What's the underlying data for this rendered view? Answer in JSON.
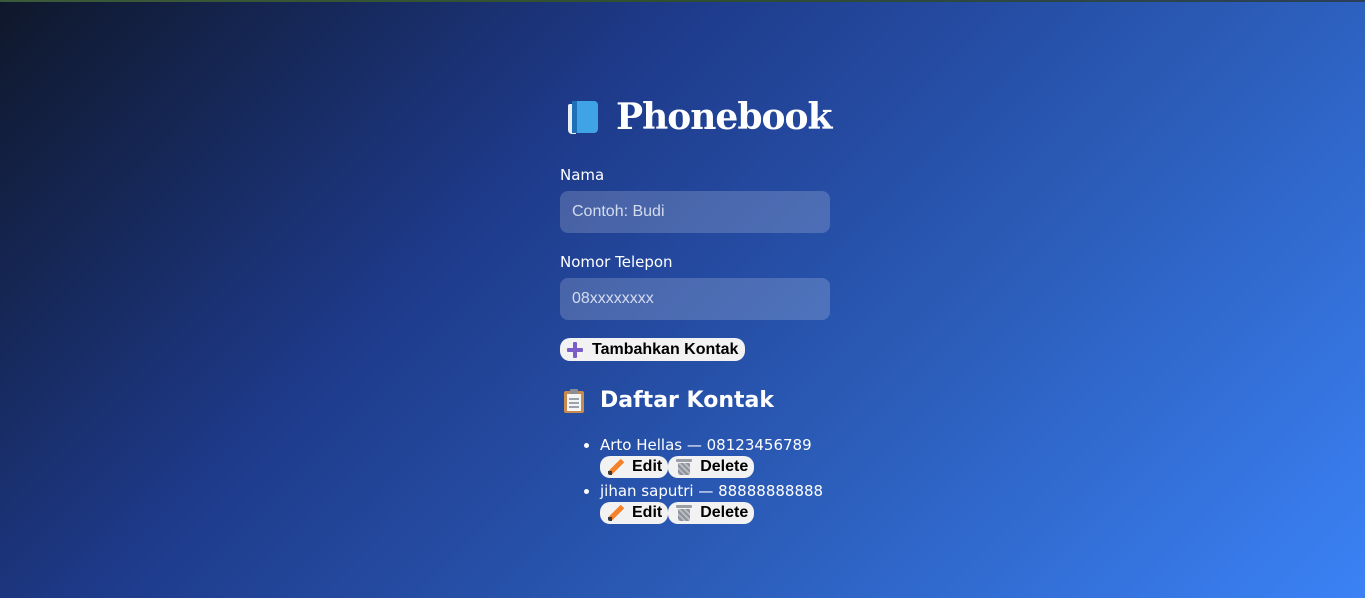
{
  "app": {
    "title": "Phonebook",
    "title_icon": "blue-book-icon"
  },
  "form": {
    "name_label": "Nama",
    "name_placeholder": "Contoh: Budi",
    "name_value": "",
    "phone_label": "Nomor Telepon",
    "phone_placeholder": "08xxxxxxxx",
    "phone_value": "",
    "add_button_label": "Tambahkan Kontak",
    "add_button_icon": "plus-icon"
  },
  "contacts_section": {
    "heading": "Daftar Kontak",
    "heading_icon": "clipboard-icon",
    "edit_label": "Edit",
    "edit_icon": "pencil-icon",
    "delete_label": "Delete",
    "delete_icon": "wastebasket-icon",
    "contacts": [
      {
        "text": "Arto Hellas — 08123456789"
      },
      {
        "text": "jihan saputri — 88888888888"
      }
    ]
  },
  "colors": {
    "background_start": "#0f172a",
    "background_end": "#3b82f6",
    "button_bg": "#f2f2f2",
    "plus_icon": "#7b5cc9",
    "book_icon": "#3fa3e6"
  }
}
